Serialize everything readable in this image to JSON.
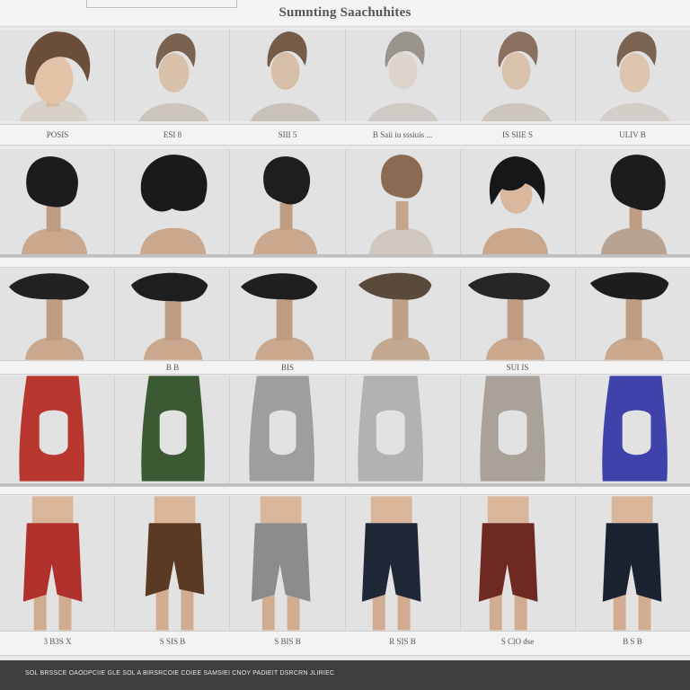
{
  "title": "Sumnting Saachuhites",
  "labels_row1": [
    "POSIS",
    "ESI  8",
    "SIII  5",
    "B   Saii  iu  sssiuis  ...",
    "IS   SIIE   S",
    "ULIV   B"
  ],
  "labels_row2": [
    "",
    "",
    "",
    "",
    "",
    ""
  ],
  "labels_row3": [
    "",
    "B  B",
    "BIS",
    "",
    "SUI  IS",
    ""
  ],
  "labels_row4": [
    "",
    "",
    "",
    "",
    "",
    ""
  ],
  "labels_row5": [
    "3   B3S  X",
    "S   SIS  B",
    "S   BIS  B",
    "R   SIS  B",
    "S  ClO  dse",
    "B   S   B"
  ],
  "footer_text": "SOL  BRSSCE  OAODPCIIE  GLE  SOL  A  BIRSRCOIE  COIEE  SAMSIEI  CNOY  PADIEIT  DSRCRN  JLIRIEC",
  "colors": {
    "hair_light": "#7a6250",
    "hair_dark": "#1c1c1c",
    "skin": "#c9a88e",
    "top_red": "#b8372f",
    "top_green": "#3b5a33",
    "top_grey": "#9e9e9e",
    "top_silver": "#b2b2b2",
    "top_stone": "#a9a29a",
    "top_blue": "#3f42a8",
    "short_red": "#b0312b",
    "short_brown": "#5a3a22",
    "short_grey": "#8c8c8c",
    "short_navy": "#202838",
    "short_maroon": "#6e2a22",
    "short_black": "#1b2230"
  }
}
